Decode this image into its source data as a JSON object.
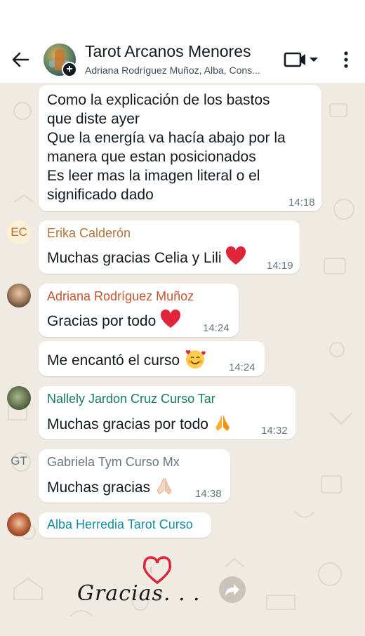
{
  "header": {
    "title": "Tarot Arcanos Menores",
    "subtitle": "Adriana Rodríguez Muñoz, Alba, Cons...",
    "avatar_badge": "+"
  },
  "colors": {
    "chat_background": "#efeae2",
    "erika": "#b3743a",
    "adriana": "#c2562f",
    "nallely": "#167a5d",
    "gabriela": "#667781",
    "alba": "#128c9e"
  },
  "messages": [
    {
      "id": "m1",
      "lines": [
        "Como la explicación de los bastos",
        "que diste ayer",
        "Que la energía va hacía abajo por la",
        "manera que estan posicionados",
        "Es leer mas la imagen literal o el",
        "significado dado"
      ],
      "time": "14:18"
    },
    {
      "id": "m2",
      "sender": "Erika Calderón",
      "avatar_initials": "EC",
      "text": "Muchas gracias Celia y Lili",
      "emoji": "red-heart",
      "time": "14:19"
    },
    {
      "id": "m3",
      "sender": "Adriana Rodríguez Muñoz",
      "text": "Gracias por todo",
      "emoji": "red-heart",
      "time": "14:24"
    },
    {
      "id": "m4",
      "text": "Me encantó el curso",
      "emoji": "smiling-face-with-hearts",
      "time": "14:24"
    },
    {
      "id": "m5",
      "sender": "Nallely Jardon Cruz Curso Tar",
      "text": "Muchas gracias por todo",
      "emoji": "folded-hands",
      "time": "14:32"
    },
    {
      "id": "m6",
      "sender": "Gabriela Tym Curso Mx",
      "avatar_initials": "GT",
      "text": "Muchas gracias",
      "emoji": "folded-hands",
      "time": "14:38"
    },
    {
      "id": "m7",
      "sender": "Alba Herredia Tarot Curso",
      "sticker_text": "Gracias. . ."
    }
  ]
}
